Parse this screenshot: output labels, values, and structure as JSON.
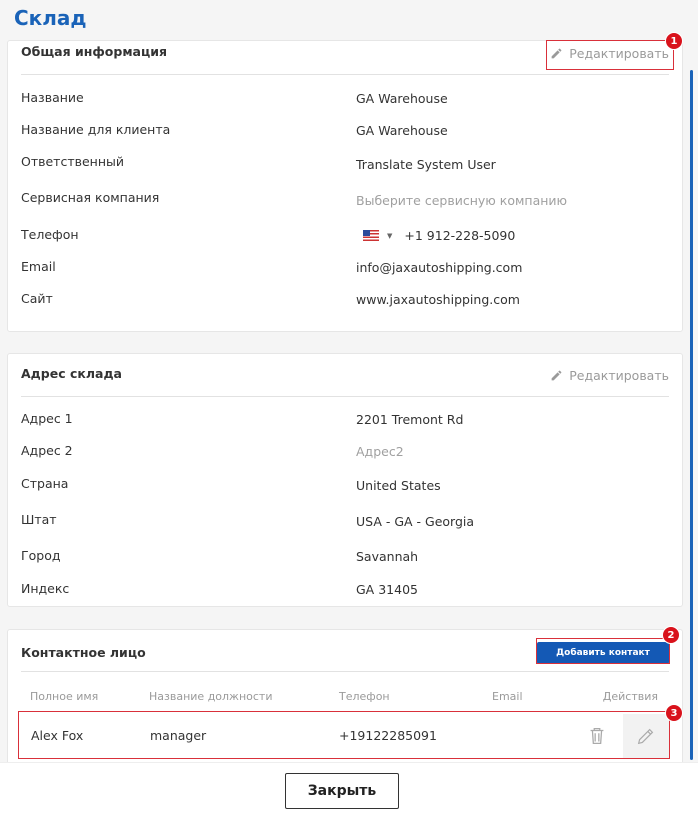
{
  "page": {
    "title": "Склад",
    "close_label": "Закрыть"
  },
  "general": {
    "title": "Общая информация",
    "edit_label": "Редактировать",
    "rows": [
      {
        "label": "Название",
        "value": "GA Warehouse"
      },
      {
        "label": "Название для клиента",
        "value": "GA Warehouse"
      },
      {
        "label": "Ответственный",
        "value": "Translate System User"
      },
      {
        "label": "Сервисная компания",
        "placeholder": "Выберите сервисную компанию"
      },
      {
        "label": "Телефон",
        "value": "+1 912-228-5090"
      },
      {
        "label": "Email",
        "value": "info@jaxautoshipping.com"
      },
      {
        "label": "Сайт",
        "value": "www.jaxautoshipping.com"
      }
    ]
  },
  "address": {
    "title": "Адрес склада",
    "edit_label": "Редактировать",
    "rows": [
      {
        "label": "Адрес 1",
        "value": "2201 Tremont Rd"
      },
      {
        "label": "Адрес 2",
        "placeholder": "Адрес2"
      },
      {
        "label": "Страна",
        "value": "United States"
      },
      {
        "label": "Штат",
        "value": "USA - GA - Georgia"
      },
      {
        "label": "Город",
        "value": "Savannah"
      },
      {
        "label": "Индекс",
        "value": "GA 31405"
      }
    ]
  },
  "contacts": {
    "title": "Контактное лицо",
    "add_label": "Добавить контакт",
    "columns": [
      "Полное имя",
      "Название должности",
      "Телефон",
      "Email",
      "Действия"
    ],
    "rows": [
      {
        "name": "Alex Fox",
        "position": "manager",
        "phone": "+19122285091",
        "email": ""
      }
    ]
  },
  "markers": [
    "1",
    "2",
    "3"
  ],
  "icons": {
    "edit": "pencil-icon",
    "delete": "trash-icon",
    "flag": "us-flag-icon"
  },
  "colors": {
    "accent": "#1a63b8",
    "button": "#1459b5",
    "marker": "#d9121b"
  }
}
